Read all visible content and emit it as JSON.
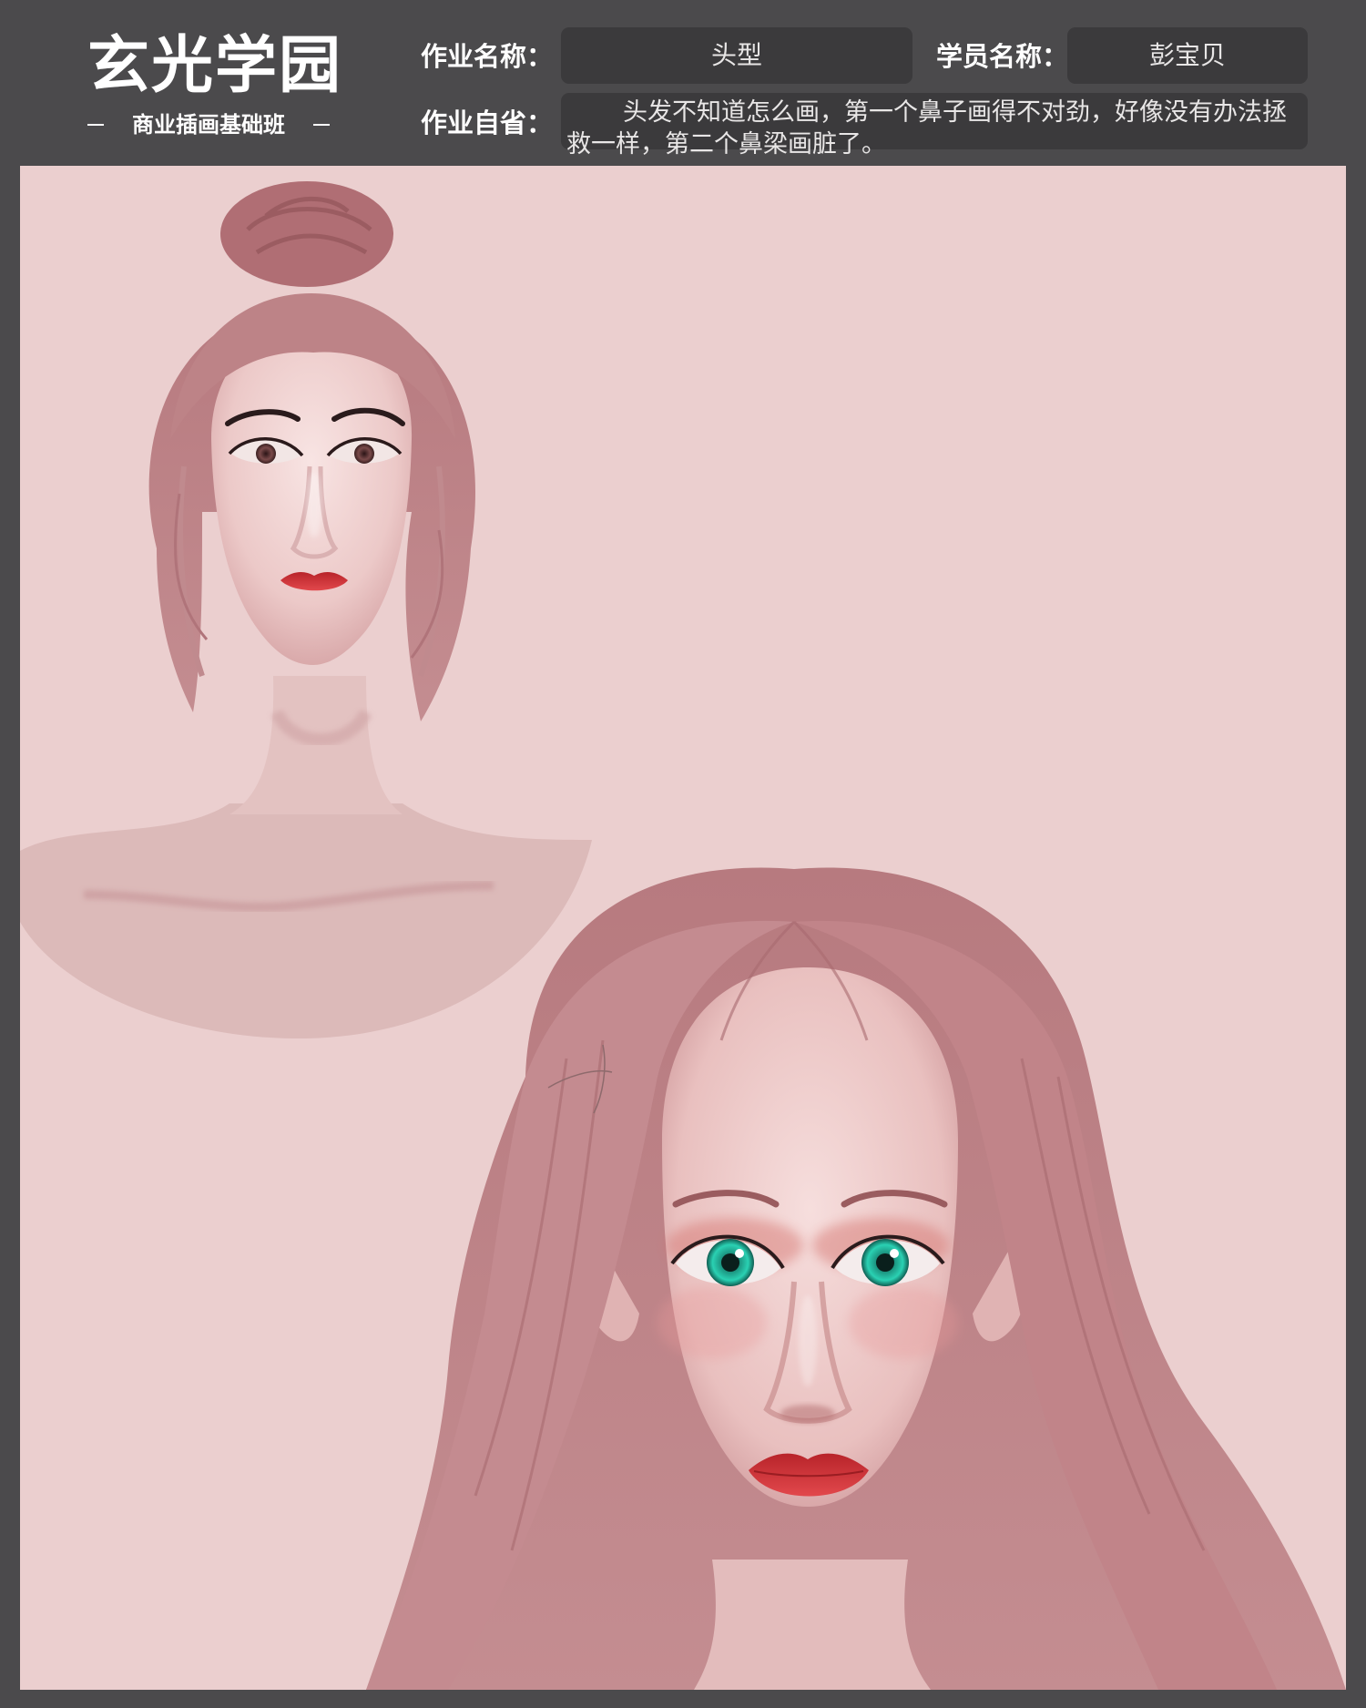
{
  "brand": {
    "title": "玄光学园",
    "subtitle": "商业插画基础班"
  },
  "form": {
    "assignment_label": "作业名称：",
    "assignment_value": "头型",
    "student_label": "学员名称：",
    "student_value": "彭宝贝",
    "reflection_label": "作业自省：",
    "reflection_value": "头发不知道怎么画，第一个鼻子画得不对劲，好像没有办法拯救一样，第二个鼻梁画脏了。"
  },
  "colors": {
    "frame": "#4b4a4c",
    "field_box": "#3b3a3c",
    "canvas": "#ebcfcf",
    "hair": "#b5767c",
    "skin": "#f1d6d6",
    "lips": "#c8302e",
    "iris_green": "#1fb59c"
  },
  "artwork": {
    "figures": [
      "updo-portrait",
      "long-hair-portrait"
    ]
  }
}
